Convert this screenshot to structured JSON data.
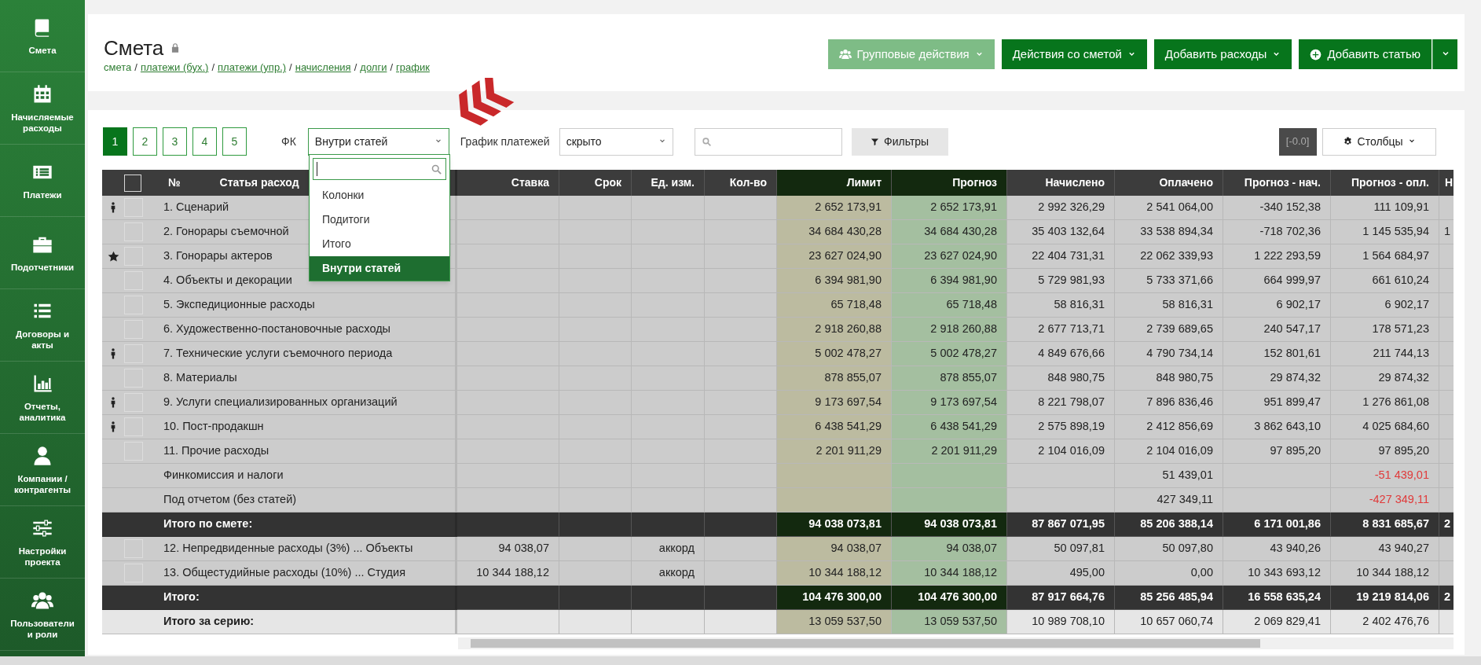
{
  "sidebar": {
    "items": [
      {
        "label": "Смета"
      },
      {
        "label": "Начисляемые расходы"
      },
      {
        "label": "Платежи"
      },
      {
        "label": "Подотчетники"
      },
      {
        "label": "Договоры и акты"
      },
      {
        "label": "Отчеты, аналитика"
      },
      {
        "label": "Компании / контрагенты"
      },
      {
        "label": "Настройки проекта"
      },
      {
        "label": "Пользователи и роли"
      }
    ]
  },
  "header": {
    "title": "Смета",
    "locked": true,
    "breadcrumbs": [
      {
        "label": "смета",
        "link": false,
        "sep": "/"
      },
      {
        "label": "платежи (бух.)",
        "link": true,
        "sep": "/"
      },
      {
        "label": "платежи (упр.)",
        "link": true,
        "sep": "/"
      },
      {
        "label": "начисления",
        "link": true,
        "sep": "/"
      },
      {
        "label": "долги",
        "link": true,
        "sep": "/"
      },
      {
        "label": "график",
        "link": true
      }
    ],
    "buttons": [
      {
        "label": "Групповые действия",
        "kind": "group"
      },
      {
        "label": "Действия со сметой",
        "kind": "menu"
      },
      {
        "label": "Добавить расходы",
        "kind": "menu"
      },
      {
        "label": "Добавить статью",
        "kind": "add"
      }
    ]
  },
  "toolbar": {
    "pages": [
      {
        "label": "1",
        "selected": true
      },
      {
        "label": "2",
        "selected": false
      },
      {
        "label": "3",
        "selected": false
      },
      {
        "label": "4",
        "selected": false
      },
      {
        "label": "5",
        "selected": false
      }
    ],
    "fk": {
      "label": "ФК",
      "value": "Внутри статей",
      "expanded": true
    },
    "schedule": {
      "label": "График платежей",
      "value": "скрыто"
    },
    "filters": "Фильтры",
    "version": "[-0.0]",
    "columns": "Столбцы"
  },
  "dropdown": {
    "options": [
      {
        "label": "Колонки",
        "selected": false
      },
      {
        "label": "Подитоги",
        "selected": false
      },
      {
        "label": "Итого",
        "selected": false
      },
      {
        "label": "Внутри статей",
        "selected": true
      }
    ]
  },
  "table": {
    "select_all": {
      "checked": false
    },
    "number_header": "№",
    "name_header": "Статья расход",
    "columns": [
      {
        "label": "Ставка",
        "kind": "plain"
      },
      {
        "label": "Срок",
        "kind": "plain"
      },
      {
        "label": "Ед. изм.",
        "kind": "plain"
      },
      {
        "label": "Кол-во",
        "kind": "plain"
      },
      {
        "label": "Лимит",
        "kind": "limit"
      },
      {
        "label": "Прогноз",
        "kind": "forecast"
      },
      {
        "label": "Начислено",
        "kind": "plain"
      },
      {
        "label": "Оплачено",
        "kind": "plain"
      },
      {
        "label": "Прогноз - нач.",
        "kind": "plain"
      },
      {
        "label": "Прогноз - опл.",
        "kind": "plain"
      },
      {
        "label": "Н",
        "kind": "cut"
      }
    ],
    "rows": [
      {
        "kind": "item",
        "assignee": true,
        "starred": false,
        "checked": false,
        "name": "1. Сценарий",
        "cells": [
          null,
          null,
          null,
          null,
          "2 652 173,91",
          "2 652 173,91",
          "2 992 326,29",
          "2 541 064,00",
          "-340 152,38",
          "111 109,91",
          null
        ]
      },
      {
        "kind": "item",
        "assignee": false,
        "starred": false,
        "checked": false,
        "name": "2. Гонорары съемочной",
        "cells": [
          null,
          null,
          null,
          null,
          "34 684 430,28",
          "34 684 430,28",
          "35 403 132,64",
          "33 538 894,34",
          "-718 702,36",
          "1 145 535,94",
          "1"
        ]
      },
      {
        "kind": "item",
        "assignee": false,
        "starred": true,
        "checked": false,
        "name": "3. Гонорары актеров",
        "cells": [
          null,
          null,
          null,
          null,
          "23 627 024,90",
          "23 627 024,90",
          "22 404 731,31",
          "22 062 339,93",
          "1 222 293,59",
          "1 564 684,97",
          null
        ]
      },
      {
        "kind": "item",
        "assignee": false,
        "starred": false,
        "checked": false,
        "name": "4. Объекты и декорации",
        "cells": [
          null,
          null,
          null,
          null,
          "6 394 981,90",
          "6 394 981,90",
          "5 729 981,93",
          "5 733 371,66",
          "664 999,97",
          "661 610,24",
          null
        ]
      },
      {
        "kind": "item",
        "assignee": false,
        "starred": false,
        "checked": false,
        "name": "5. Экспедиционные расходы",
        "cells": [
          null,
          null,
          null,
          null,
          "65 718,48",
          "65 718,48",
          "58 816,31",
          "58 816,31",
          "6 902,17",
          "6 902,17",
          null
        ]
      },
      {
        "kind": "item",
        "assignee": false,
        "starred": false,
        "checked": false,
        "name": "6. Художественно-постановочные расходы",
        "cells": [
          null,
          null,
          null,
          null,
          "2 918 260,88",
          "2 918 260,88",
          "2 677 713,71",
          "2 739 689,65",
          "240 547,17",
          "178 571,23",
          null
        ]
      },
      {
        "kind": "item",
        "assignee": true,
        "starred": false,
        "checked": false,
        "name": "7. Технические услуги съемочного периода",
        "cells": [
          null,
          null,
          null,
          null,
          "5 002 478,27",
          "5 002 478,27",
          "4 849 676,66",
          "4 790 734,14",
          "152 801,61",
          "211 744,13",
          null
        ]
      },
      {
        "kind": "item",
        "assignee": false,
        "starred": false,
        "checked": false,
        "name": "8. Материалы",
        "cells": [
          null,
          null,
          null,
          null,
          "878 855,07",
          "878 855,07",
          "848 980,75",
          "848 980,75",
          "29 874,32",
          "29 874,32",
          null
        ]
      },
      {
        "kind": "item",
        "assignee": true,
        "starred": false,
        "checked": false,
        "name": "9. Услуги специализированных организаций",
        "cells": [
          null,
          null,
          null,
          null,
          "9 173 697,54",
          "9 173 697,54",
          "8 221 798,07",
          "7 896 836,46",
          "951 899,47",
          "1 276 861,08",
          null
        ]
      },
      {
        "kind": "item",
        "assignee": true,
        "starred": false,
        "checked": false,
        "name": "10. Пост-продакшн",
        "cells": [
          null,
          null,
          null,
          null,
          "6 438 541,29",
          "6 438 541,29",
          "2 575 898,19",
          "2 412 856,69",
          "3 862 643,10",
          "4 025 684,60",
          null
        ]
      },
      {
        "kind": "item",
        "assignee": false,
        "starred": false,
        "checked": false,
        "name": "11. Прочие расходы",
        "cells": [
          null,
          null,
          null,
          null,
          "2 201 911,29",
          "2 201 911,29",
          "2 104 016,09",
          "2 104 016,09",
          "97 895,20",
          "97 895,20",
          null
        ]
      },
      {
        "kind": "plain",
        "name": "Финкомиссия и налоги",
        "cells": [
          null,
          null,
          null,
          null,
          null,
          null,
          null,
          "51 439,01",
          null,
          {
            "text": "-51 439,01",
            "alert": true
          },
          null
        ]
      },
      {
        "kind": "plain",
        "name": "Под отчетом (без статей)",
        "cells": [
          null,
          null,
          null,
          null,
          null,
          null,
          null,
          "427 349,11",
          null,
          {
            "text": "-427 349,11",
            "alert": true
          },
          null
        ]
      },
      {
        "kind": "total",
        "name": "Итого по смете:",
        "cells": [
          null,
          null,
          null,
          null,
          "94 038 073,81",
          "94 038 073,81",
          "87 867 071,95",
          "85 206 388,14",
          "6 171 001,86",
          "8 831 685,67",
          "2"
        ]
      },
      {
        "kind": "item",
        "assignee": false,
        "starred": false,
        "checked": false,
        "name": "12. Непредвиденные расходы (3%) ... Объекты",
        "cells": [
          "94 038,07",
          null,
          "аккорд",
          null,
          "94 038,07",
          "94 038,07",
          "50 097,81",
          "50 097,80",
          "43 940,26",
          "43 940,27",
          null
        ]
      },
      {
        "kind": "item",
        "assignee": false,
        "starred": false,
        "checked": false,
        "name": "13. Общестудийные расходы (10%) ... Студия",
        "cells": [
          "10 344 188,12",
          null,
          "аккорд",
          null,
          "10 344 188,12",
          "10 344 188,12",
          "495,00",
          "0,00",
          "10 343 693,12",
          "10 344 188,12",
          null
        ]
      },
      {
        "kind": "total",
        "name": "Итого:",
        "cells": [
          null,
          null,
          null,
          null,
          "104 476 300,00",
          "104 476 300,00",
          "87 917 664,76",
          "85 256 485,94",
          "16 558 635,24",
          "19 219 814,06",
          "2"
        ]
      },
      {
        "kind": "series",
        "name": "Итого за серию:",
        "cells": [
          null,
          null,
          null,
          null,
          "13 059 537,50",
          "13 059 537,50",
          "10 989 708,10",
          "10 657 060,74",
          "2 069 829,41",
          "2 402 476,76",
          null
        ]
      }
    ]
  }
}
